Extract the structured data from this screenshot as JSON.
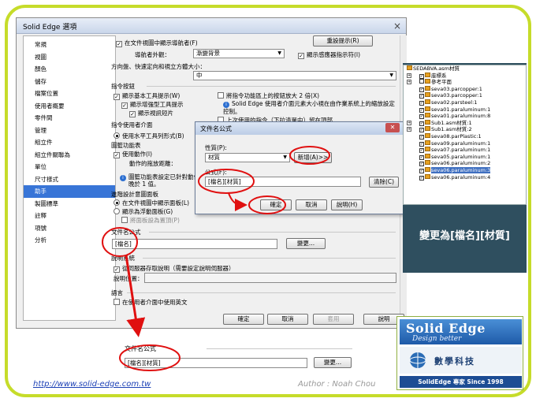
{
  "dialog": {
    "title": "Solid Edge 選項",
    "close": "×",
    "nav_items": [
      "常規",
      "視圖",
      "顏色",
      "儲存",
      "檔案位置",
      "使用者概要",
      "零件間",
      "管理",
      "組立件",
      "組立件關聯為",
      "單位",
      "尺寸樣式",
      "助手",
      "製圖標準",
      "註釋",
      "項號",
      "分析"
    ],
    "selected_nav": "助手",
    "show_navigator": "在文件視圖中顯示導航者(F)",
    "reset_tips_btn": "重設提示(R)",
    "navigator_appearance_label": "導航者外觀：",
    "navigator_appearance_value": "漸變背景",
    "sensor_indicator": "顯示感應器指示符(I)",
    "direction_size_label": "方向盤、快速定向和視立方體大小：",
    "direction_size_value": "中",
    "cmd_buttons_section": "指令按鈕",
    "show_basic_tips": "顯示基本工具提示(W)",
    "show_enhanced_tips": "顯示增強型工具提示",
    "show_video_clip": "顯示視訊短片",
    "double_cmd_area": "將指令功能區上的按鈕放大 2 倍(X)",
    "info_ui_scale": "Solid Edge 使用者介面元素大小視在由作業系統上的縮放設定控制。",
    "recent_cmd_top": "上次使用的指令（下拉清單中）留在頂部",
    "cmd_ui_section": "指令使用者介面",
    "use_horizontal_toolbar": "使用水平工具列形式(B)",
    "pic_section": "圖籃功能表",
    "use_motion": "使用動作(I)",
    "motion_drag_distance": "動作的拖放距離：",
    "pic_info": "圖籃功能表設定已針對動作將按鈕配置...",
    "pic_info2": "晚於 1 值。",
    "advance_panel_section": "進階設計意圖面板",
    "show_in_doc_view": "在文件視圖中顯示面板(L)",
    "show_floating": "顯示為浮動面板(G)",
    "panel_topmost": "將面板設為置頂(P)",
    "file_formula_section": "文件名公式",
    "file_formula_value": "[檔名]",
    "change_btn": "變更...",
    "desc_section": "說明系統",
    "fetch_from_server": "從伺服器存取說明（需要設定說明伺服器）",
    "help_location_label": "說明位置：",
    "lang_section": "語言",
    "use_english": "在使用者介面中使用英文",
    "ok": "確定",
    "cancel": "取消",
    "apply": "套用",
    "help": "說明"
  },
  "formula_dialog": {
    "title": "文件名公式",
    "property_label": "性質(P):",
    "property_value": "材質",
    "add_btn": "新增(A)>>",
    "formula_label": "公式(F):",
    "formula_value": "[檔名][材質]",
    "clear_btn": "清除(C)",
    "ok": "確定",
    "cancel": "取消",
    "help": "說明(H)"
  },
  "tree": {
    "rows": [
      {
        "text": "SEDABVA.asm材質",
        "level": 0,
        "expander": "",
        "check": false,
        "highlight": false
      },
      {
        "text": "座標系",
        "level": 1,
        "expander": "+",
        "check": true,
        "highlight": false
      },
      {
        "text": "參考平面",
        "level": 1,
        "expander": "+",
        "check": false,
        "highlight": false
      },
      {
        "text": "seva03.parcopper:1",
        "level": 1,
        "expander": "",
        "check": true,
        "highlight": false
      },
      {
        "text": "seva03.parcopper:1",
        "level": 1,
        "expander": "",
        "check": true,
        "highlight": false
      },
      {
        "text": "seva02.parsteel:1",
        "level": 1,
        "expander": "",
        "check": true,
        "highlight": false
      },
      {
        "text": "seva01.paraluminum:1",
        "level": 1,
        "expander": "",
        "check": true,
        "highlight": false
      },
      {
        "text": "seva01.paraluminum:8",
        "level": 1,
        "expander": "",
        "check": true,
        "highlight": false
      },
      {
        "text": "Sub1.asm材質:1",
        "level": 1,
        "expander": "+",
        "check": true,
        "highlight": false
      },
      {
        "text": "Sub1.asm材質:2",
        "level": 1,
        "expander": "+",
        "check": true,
        "highlight": false
      },
      {
        "text": "seva08.parPlastic:1",
        "level": 1,
        "expander": "",
        "check": true,
        "highlight": false
      },
      {
        "text": "seva09.paraluminum:1",
        "level": 1,
        "expander": "",
        "check": true,
        "highlight": false
      },
      {
        "text": "seva07.paraluminum:1",
        "level": 1,
        "expander": "",
        "check": true,
        "highlight": false
      },
      {
        "text": "seva05.paraluminum:1",
        "level": 1,
        "expander": "",
        "check": true,
        "highlight": false
      },
      {
        "text": "seva06.paraluminum:2",
        "level": 1,
        "expander": "",
        "check": true,
        "highlight": false
      },
      {
        "text": "seva06.paraluminum:3",
        "level": 1,
        "expander": "",
        "check": true,
        "highlight": true
      },
      {
        "text": "seva06.paraluminum:4",
        "level": 1,
        "expander": "",
        "check": true,
        "highlight": false
      }
    ],
    "caption": "變更為[檔名][材質]"
  },
  "clip": {
    "title": "文件名公式",
    "value": "[檔名][材質]",
    "change_btn": "變更..."
  },
  "logo": {
    "name": "Solid Edge",
    "tagline": "Design better",
    "company": "數學科技",
    "bottom": "SolidEdge 專家 Since 1998"
  },
  "footer": {
    "url": "http://www.solid-edge.com.tw",
    "author": "Author : Noah Chou"
  },
  "colors": {
    "frame": "#c6dc2a",
    "highlight_red": "#e01010",
    "selection_blue": "#3875d7",
    "tree_bg": "#2f4f5f"
  }
}
